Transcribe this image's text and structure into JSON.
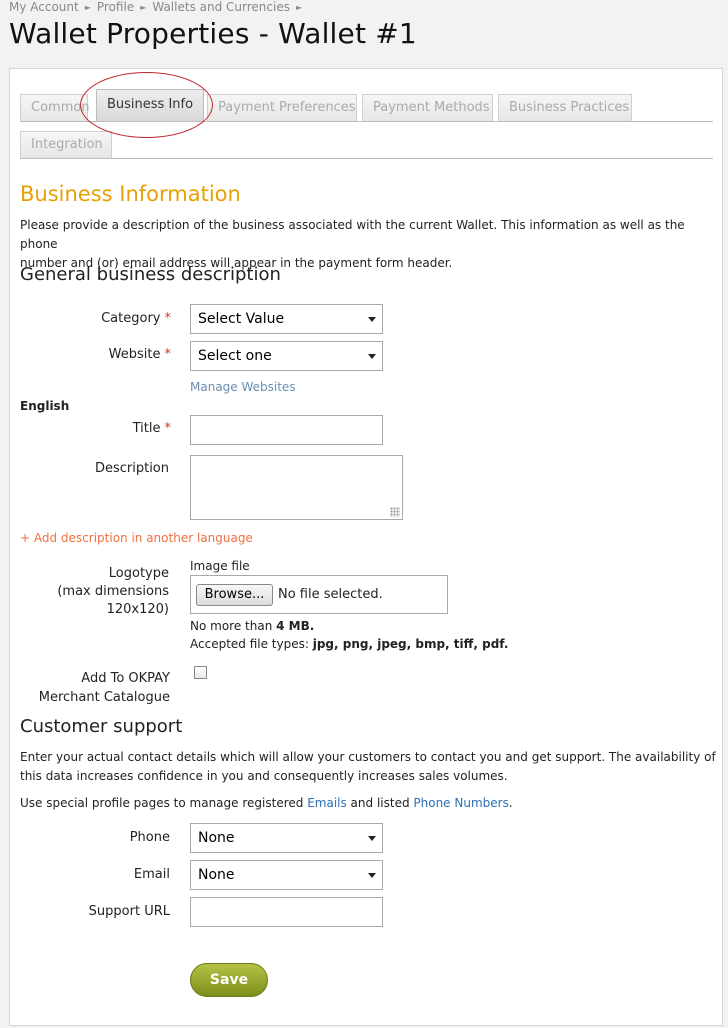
{
  "breadcrumb": [
    "My Account",
    "Profile",
    "Wallets and Currencies"
  ],
  "page_title": "Wallet Properties - Wallet #1",
  "tabs": {
    "common": "Common",
    "business_info": "Business Info",
    "payment_preferences": "Payment Preferences",
    "payment_methods": "Payment Methods",
    "business_practices": "Business Practices",
    "integration": "Integration"
  },
  "business": {
    "title": "Business Information",
    "intro_line1": "Please provide a description of the business associated with the current Wallet. This information as well as the phone",
    "intro_line2": "number and (or) email address will appear in the payment form header."
  },
  "general": {
    "heading": "General business description",
    "category_label": "Category",
    "category_value": "Select Value",
    "website_label": "Website",
    "website_value": "Select one",
    "manage_websites": "Manage Websites",
    "language": "English",
    "title_label": "Title",
    "description_label": "Description",
    "add_language": "+ Add description in another language",
    "logotype_label": "Logotype",
    "logotype_hint1": "(max dimensions",
    "logotype_hint2": "120x120)",
    "image_file_label": "Image file",
    "browse_label": "Browse...",
    "file_status": "No file selected.",
    "size_note_prefix": "No more than ",
    "size_note_value": "4 MB.",
    "types_note_prefix": "Accepted file types: ",
    "types_note_value": "jpg, png, jpeg, bmp, tiff, pdf.",
    "catalogue_label1": "Add To OKPAY",
    "catalogue_label2": "Merchant Catalogue",
    "required_mark": "*"
  },
  "support": {
    "heading": "Customer support",
    "intro_line1": "Enter your actual contact details which will allow your customers to contact you and get support. The availability of",
    "intro_line2": "this data increases confidence in you and consequently increases sales volumes.",
    "profile_text_prefix": "Use special profile pages to manage registered ",
    "emails_link": "Emails",
    "profile_text_middle": " and listed ",
    "phones_link": "Phone Numbers",
    "profile_text_suffix": ".",
    "phone_label": "Phone",
    "phone_value": "None",
    "email_label": "Email",
    "email_value": "None",
    "support_url_label": "Support URL"
  },
  "save_label": "Save",
  "colors": {
    "section_title": "#e8a000",
    "link": "#2d6fb5",
    "add_language_link": "#f07040",
    "manage_websites_link": "#6a8fb0",
    "save_button": "#8a9a22"
  }
}
